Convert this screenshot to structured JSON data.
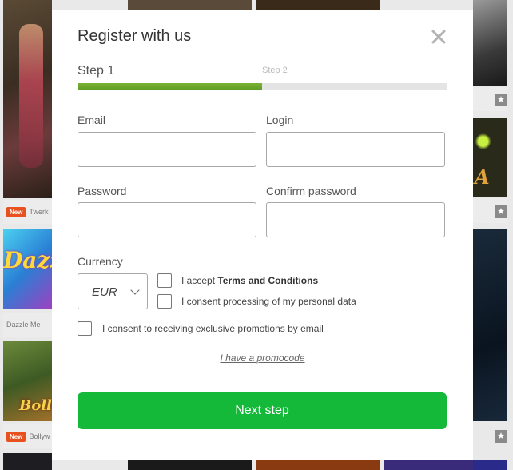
{
  "background": {
    "tiles": [
      {
        "label": "Twerk",
        "badge": "New"
      },
      {
        "label": "Dazzle Me",
        "badge": "",
        "art_text": "Dazz"
      },
      {
        "label": "Bollyw",
        "badge": "New",
        "art_text": "Bolly"
      }
    ],
    "right_art_text": "A"
  },
  "modal": {
    "title": "Register with us",
    "close_icon": "close-icon",
    "steps": {
      "step1": "Step 1",
      "step2": "Step 2",
      "progress": 0.5
    },
    "fields": {
      "email": {
        "label": "Email",
        "value": ""
      },
      "login": {
        "label": "Login",
        "value": ""
      },
      "password": {
        "label": "Password",
        "value": ""
      },
      "confirm_password": {
        "label": "Confirm password",
        "value": ""
      }
    },
    "currency": {
      "label": "Currency",
      "value": "EUR"
    },
    "consents": {
      "terms_prefix": "I accept ",
      "terms_link": "Terms and Conditions",
      "personal_data": "I consent processing of my personal data",
      "promotions": "I consent to receiving exclusive promotions by email"
    },
    "promo_link": "I have a promocode",
    "next_button": "Next step"
  }
}
